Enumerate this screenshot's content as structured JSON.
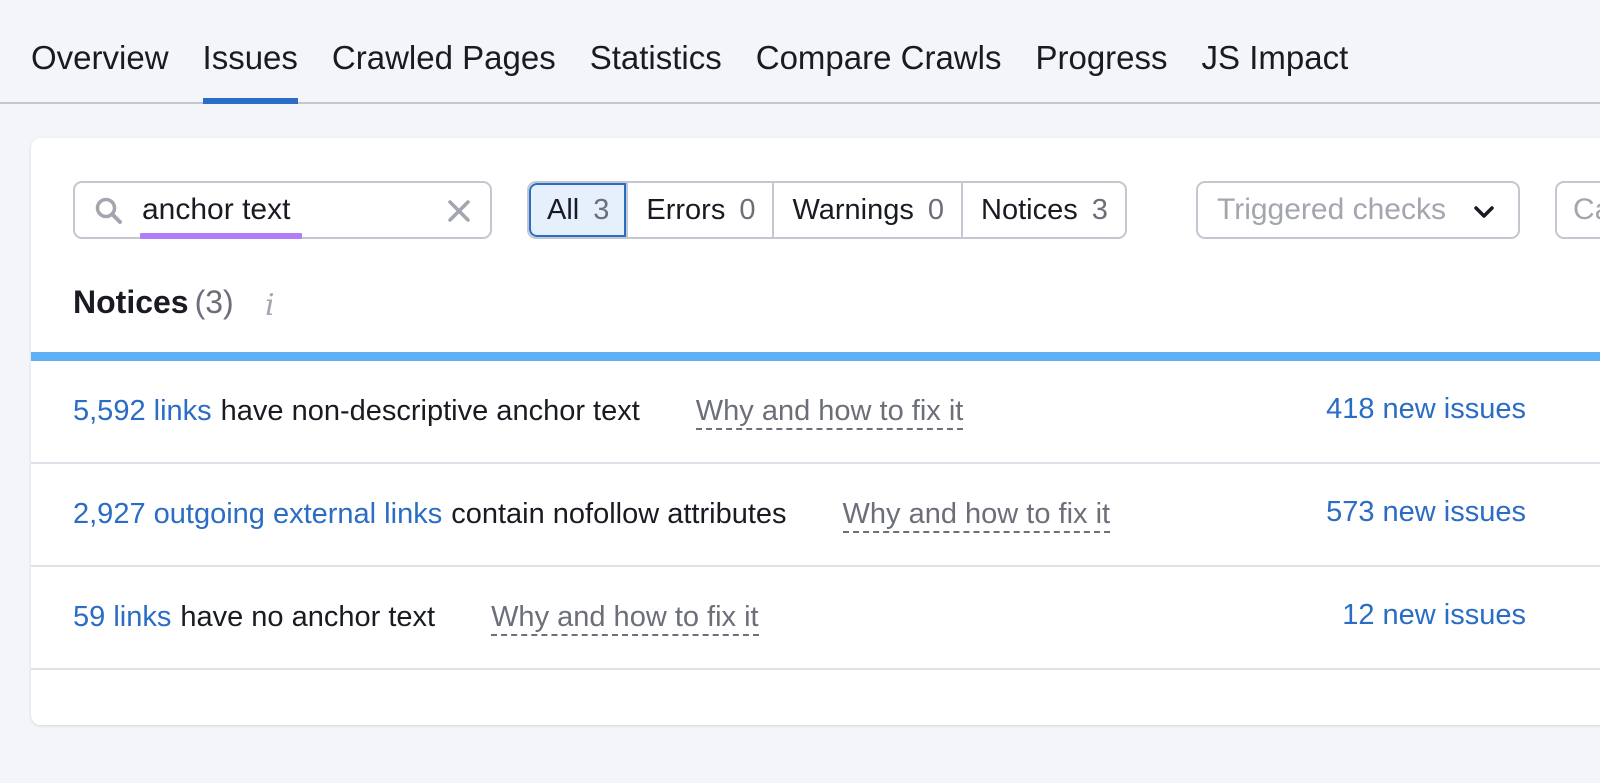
{
  "tabs": [
    {
      "label": "Overview",
      "active": false
    },
    {
      "label": "Issues",
      "active": true
    },
    {
      "label": "Crawled Pages",
      "active": false
    },
    {
      "label": "Statistics",
      "active": false
    },
    {
      "label": "Compare Crawls",
      "active": false
    },
    {
      "label": "Progress",
      "active": false
    },
    {
      "label": "JS Impact",
      "active": false
    }
  ],
  "search": {
    "value": "anchor text",
    "icon": "search-icon",
    "clear_icon": "close-icon"
  },
  "filters": [
    {
      "label": "All",
      "count": "3",
      "active": true
    },
    {
      "label": "Errors",
      "count": "0",
      "active": false
    },
    {
      "label": "Warnings",
      "count": "0",
      "active": false
    },
    {
      "label": "Notices",
      "count": "3",
      "active": false
    }
  ],
  "triggered_checks": {
    "placeholder": "Triggered checks",
    "icon": "chevron-down-icon"
  },
  "category_dropdown": {
    "placeholder_partial": "Ca"
  },
  "section": {
    "title": "Notices",
    "count": "(3)",
    "info_icon": "i"
  },
  "issues": [
    {
      "count_link": "5,592 links",
      "description": "have non-descriptive anchor text",
      "fix_link": "Why and how to fix it",
      "new_issues": "418 new issues"
    },
    {
      "count_link": "2,927 outgoing external links",
      "description": "contain nofollow attributes",
      "fix_link": "Why and how to fix it",
      "new_issues": "573 new issues"
    },
    {
      "count_link": "59 links",
      "description": "have no anchor text",
      "fix_link": "Why and how to fix it",
      "new_issues": "12 new issues"
    }
  ],
  "colors": {
    "accent": "#2b6cc4",
    "notice_bar": "#5eb0f5",
    "highlight_underline": "#b07ff7",
    "background": "#f4f5f9"
  }
}
